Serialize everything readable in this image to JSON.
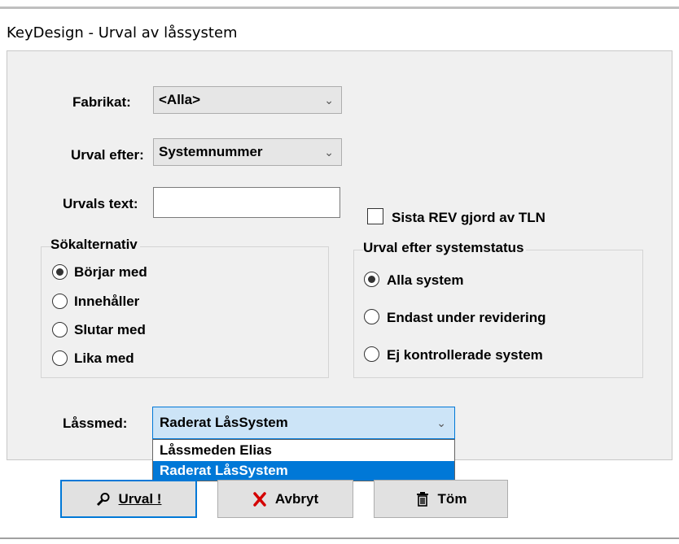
{
  "window": {
    "title": "KeyDesign - Urval av låssystem"
  },
  "form": {
    "fabrikat_label": "Fabrikat:",
    "fabrikat_value": "<Alla>",
    "urval_efter_label": "Urval efter:",
    "urval_efter_value": "Systemnummer",
    "urvals_text_label": "Urvals text:",
    "urvals_text_value": "",
    "sista_rev_label": "Sista REV gjord av TLN",
    "sista_rev_checked": false
  },
  "sokalternativ": {
    "legend": "Sökalternativ",
    "options": [
      {
        "label": "Börjar med",
        "checked": true
      },
      {
        "label": "Innehåller",
        "checked": false
      },
      {
        "label": "Slutar med",
        "checked": false
      },
      {
        "label": "Lika med",
        "checked": false
      }
    ]
  },
  "systemstatus": {
    "legend": "Urval efter systemstatus",
    "options": [
      {
        "label": "Alla system",
        "checked": true
      },
      {
        "label": "Endast under revidering",
        "checked": false
      },
      {
        "label": "Ej kontrollerade system",
        "checked": false
      }
    ]
  },
  "lassmed": {
    "label": "Låssmed:",
    "value": "Raderat LåsSystem",
    "options": [
      "Låssmeden Elias",
      "Raderat LåsSystem"
    ],
    "selected_index": 1
  },
  "buttons": {
    "urval_label": "Urval !",
    "avbryt_label": "Avbryt",
    "tom_label": "Töm"
  },
  "colors": {
    "accent": "#0078d7",
    "panel_bg": "#f0f0f0",
    "button_bg": "#e1e1e1",
    "cancel_icon": "#d40000"
  },
  "icons": {
    "urval": "magnifier-icon",
    "avbryt": "red-x-icon",
    "tom": "trash-icon"
  }
}
